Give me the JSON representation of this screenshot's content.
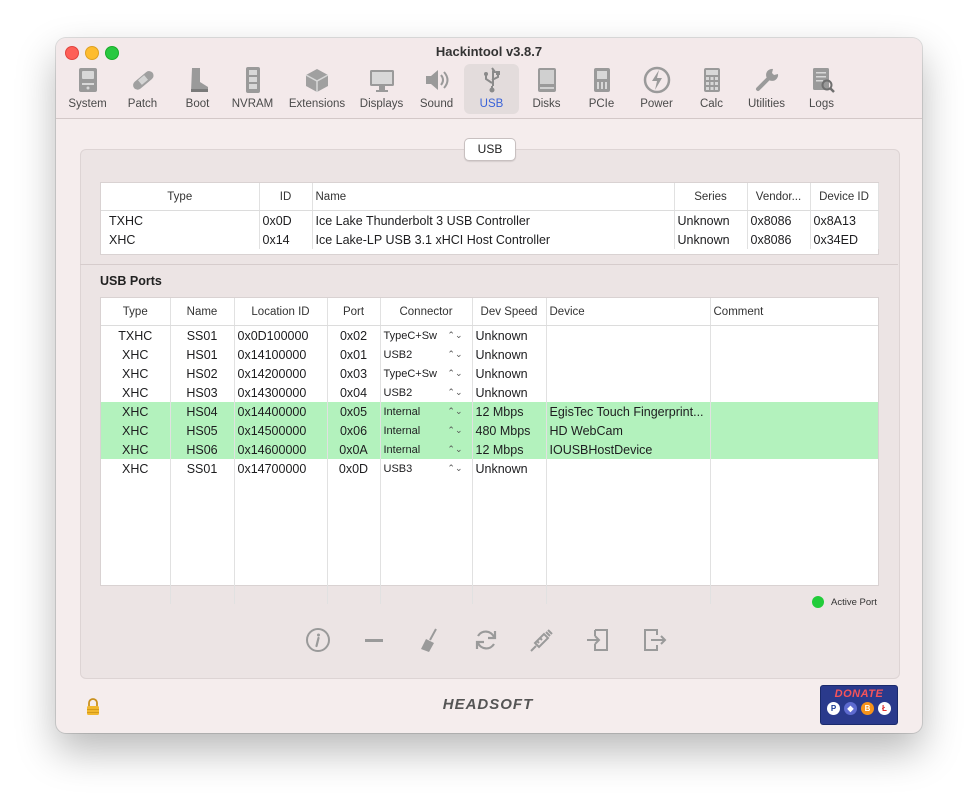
{
  "window": {
    "title": "Hackintool v3.8.7"
  },
  "toolbar": {
    "items": [
      {
        "label": "System",
        "icon": "system-icon"
      },
      {
        "label": "Patch",
        "icon": "patch-icon"
      },
      {
        "label": "Boot",
        "icon": "boot-icon"
      },
      {
        "label": "NVRAM",
        "icon": "nvram-icon"
      },
      {
        "label": "Extensions",
        "icon": "extensions-icon"
      },
      {
        "label": "Displays",
        "icon": "displays-icon"
      },
      {
        "label": "Sound",
        "icon": "sound-icon"
      },
      {
        "label": "USB",
        "icon": "usb-icon",
        "active": true
      },
      {
        "label": "Disks",
        "icon": "disks-icon"
      },
      {
        "label": "PCIe",
        "icon": "pcie-icon"
      },
      {
        "label": "Power",
        "icon": "power-icon"
      },
      {
        "label": "Calc",
        "icon": "calc-icon"
      },
      {
        "label": "Utilities",
        "icon": "utilities-icon"
      },
      {
        "label": "Logs",
        "icon": "logs-icon"
      }
    ]
  },
  "usb_tab_label": "USB",
  "controllers": {
    "headers": [
      "Type",
      "ID",
      "Name",
      "Series",
      "Vendor...",
      "Device ID"
    ],
    "rows": [
      [
        "TXHC",
        "0x0D",
        "Ice Lake Thunderbolt 3 USB Controller",
        "Unknown",
        "0x8086",
        "0x8A13"
      ],
      [
        "XHC",
        "0x14",
        "Ice Lake-LP USB 3.1 xHCI Host Controller",
        "Unknown",
        "0x8086",
        "0x34ED"
      ]
    ]
  },
  "ports": {
    "title": "USB Ports",
    "headers": [
      "Type",
      "Name",
      "Location ID",
      "Port",
      "Connector",
      "Dev Speed",
      "Device",
      "Comment"
    ],
    "rows": [
      {
        "type": "TXHC",
        "name": "SS01",
        "location": "0x0D100000",
        "port": "0x02",
        "connector": "TypeC+Sw",
        "speed": "Unknown",
        "device": "",
        "comment": "",
        "active": false
      },
      {
        "type": "XHC",
        "name": "HS01",
        "location": "0x14100000",
        "port": "0x01",
        "connector": "USB2",
        "speed": "Unknown",
        "device": "",
        "comment": "",
        "active": false
      },
      {
        "type": "XHC",
        "name": "HS02",
        "location": "0x14200000",
        "port": "0x03",
        "connector": "TypeC+Sw",
        "speed": "Unknown",
        "device": "",
        "comment": "",
        "active": false
      },
      {
        "type": "XHC",
        "name": "HS03",
        "location": "0x14300000",
        "port": "0x04",
        "connector": "USB2",
        "speed": "Unknown",
        "device": "",
        "comment": "",
        "active": false
      },
      {
        "type": "XHC",
        "name": "HS04",
        "location": "0x14400000",
        "port": "0x05",
        "connector": "Internal",
        "speed": "12 Mbps",
        "device": "EgisTec Touch Fingerprint...",
        "comment": "",
        "active": true
      },
      {
        "type": "XHC",
        "name": "HS05",
        "location": "0x14500000",
        "port": "0x06",
        "connector": "Internal",
        "speed": "480 Mbps",
        "device": "HD WebCam",
        "comment": "",
        "active": true
      },
      {
        "type": "XHC",
        "name": "HS06",
        "location": "0x14600000",
        "port": "0x0A",
        "connector": "Internal",
        "speed": "12 Mbps",
        "device": "IOUSBHostDevice",
        "comment": "",
        "active": true
      },
      {
        "type": "XHC",
        "name": "SS01",
        "location": "0x14700000",
        "port": "0x0D",
        "connector": "USB3",
        "speed": "Unknown",
        "device": "",
        "comment": "",
        "active": false
      }
    ]
  },
  "legend": {
    "label": "Active Port",
    "color": "#22cc3a"
  },
  "actions": [
    "info-icon",
    "remove-icon",
    "clear-icon",
    "refresh-icon",
    "inject-icon",
    "import-icon",
    "export-icon"
  ],
  "footer": {
    "brand": "HEADSOFT",
    "donate_label": "DONATE",
    "coins": [
      "paypal-icon",
      "ethereum-icon",
      "bitcoin-icon",
      "litecoin-icon"
    ]
  },
  "colors": {
    "active_row": "#b3f2bd",
    "accent": "#3a63d8"
  }
}
